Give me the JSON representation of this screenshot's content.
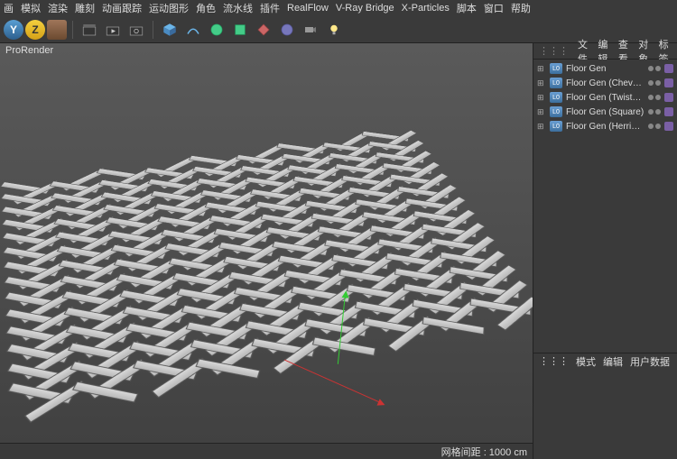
{
  "menu": {
    "items": [
      "画",
      "模拟",
      "渲染",
      "雕刻",
      "动画跟踪",
      "运动图形",
      "角色",
      "流水线",
      "插件",
      "RealFlow",
      "V-Ray Bridge",
      "X-Particles",
      "脚本",
      "窗口",
      "帮助"
    ]
  },
  "toolbar": {
    "y_label": "Y",
    "z_label": "Z"
  },
  "viewport": {
    "label": "ProRender",
    "grid_info": "网格间距 : 1000 cm"
  },
  "panel_tabs_top": [
    "文件",
    "编辑",
    "查看",
    "对象",
    "标签"
  ],
  "objects": [
    {
      "name": "Floor Gen"
    },
    {
      "name": "Floor Gen (Chevron)"
    },
    {
      "name": "Floor Gen (Twisted)"
    },
    {
      "name": "Floor Gen (Square)"
    },
    {
      "name": "Floor Gen (Herring-B)"
    }
  ],
  "panel_tabs_bottom": [
    "模式",
    "编辑",
    "用户数据"
  ]
}
